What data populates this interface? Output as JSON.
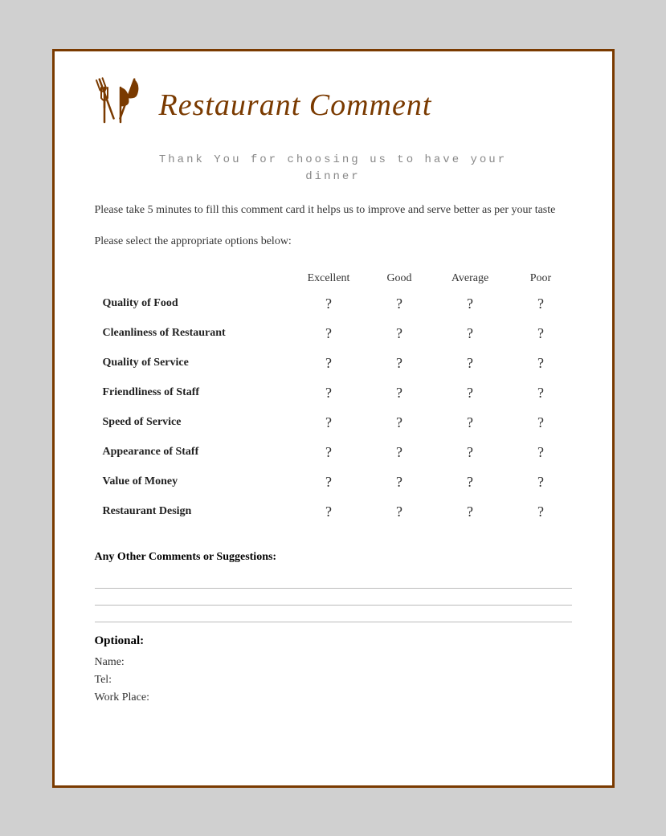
{
  "header": {
    "title": "Restaurant Comment"
  },
  "thank_you": {
    "line1": "Thank You for choosing us to have your",
    "line2": "dinner"
  },
  "description": "Please take 5 minutes to fill this comment card it helps us to improve and serve better as per your taste",
  "instruction": "Please select the appropriate options below:",
  "columns": {
    "excellent": "Excellent",
    "good": "Good",
    "average": "Average",
    "poor": "Poor"
  },
  "rows": [
    {
      "category": "Quality of Food"
    },
    {
      "category": "Cleanliness of Restaurant"
    },
    {
      "category": "Quality of Service"
    },
    {
      "category": "Friendliness of Staff"
    },
    {
      "category": "Speed of Service"
    },
    {
      "category": "Appearance of Staff"
    },
    {
      "category": "Value of Money"
    },
    {
      "category": "Restaurant Design"
    }
  ],
  "option_symbol": "?",
  "comments": {
    "label": "Any Other Comments or Suggestions:"
  },
  "optional": {
    "title": "Optional:",
    "name_label": "Name:",
    "tel_label": "Tel:",
    "workplace_label": "Work Place:"
  }
}
